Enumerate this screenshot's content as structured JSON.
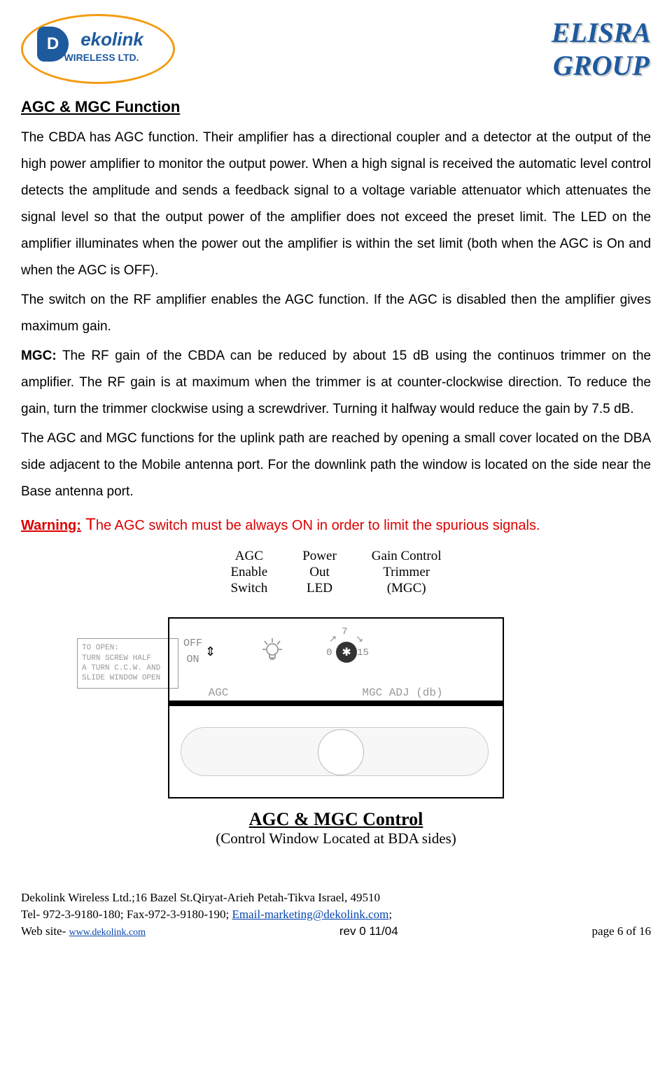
{
  "header": {
    "logo_main": "ekolink",
    "logo_sub": "WIRELESS LTD.",
    "logo_d": "D",
    "right_line1": "ELISRA",
    "right_line2": "GROUP"
  },
  "section": {
    "title": "AGC & MGC Function",
    "p1": "The CBDA has AGC function. Their amplifier has a directional coupler and a detector at the output of the high power amplifier to monitor the output power.  When a high signal is received the automatic level control detects the amplitude and sends a feedback signal to a voltage variable attenuator which attenuates the signal level so that the output power of the amplifier does not exceed the preset limit. The LED on the amplifier illuminates when the power out the amplifier is within the set limit (both when the AGC is On and when the AGC is OFF).",
    "p2": "The switch on the RF amplifier enables the AGC function. If the AGC is disabled then the amplifier gives maximum gain.",
    "mgc_label": "MGC:",
    "p3": " The RF gain of the CBDA can be reduced by about 15 dB using the continuos trimmer on the amplifier. The RF gain is at maximum when the trimmer is at counter-clockwise direction. To reduce the gain, turn the trimmer clockwise using a screwdriver. Turning it halfway would reduce the gain by 7.5 dB.",
    "p4": "The AGC and MGC functions for the uplink path are reached by opening a small cover located on the DBA side adjacent to the Mobile antenna port. For the downlink path the window is located on the side near the Base antenna port.",
    "warning_label": "Warning:",
    "warning_t": " T",
    "warning_text": "he AGC switch must be always ON in order to limit the spurious signals."
  },
  "callouts": {
    "c1_l1": "AGC",
    "c1_l2": "Enable",
    "c1_l3": "Switch",
    "c2_l1": "Power",
    "c2_l2": "Out",
    "c2_l3": "LED",
    "c3_l1": "Gain Control",
    "c3_l2": "Trimmer",
    "c3_l3": "(MGC)"
  },
  "diagram": {
    "off": "OFF",
    "on": "ON",
    "t0": "0",
    "t7": "7",
    "t15": "15",
    "bar_agc": "AGC",
    "bar_mgc": "MGC ADJ (db)",
    "panel_l1": "TO OPEN:",
    "panel_l2": "TURN SCREW HALF",
    "panel_l3": "A TURN C.C.W. AND",
    "panel_l4": "SLIDE WINDOW OPEN"
  },
  "figure": {
    "title": "AGC & MGC Control",
    "subtitle": "(Control Window Located at BDA sides)"
  },
  "footer": {
    "l1": "Dekolink Wireless Ltd.;16 Bazel St.Qiryat-Arieh Petah-Tikva Israel, 49510",
    "l2a": "Tel- 972-3-9180-180; Fax-972-3-9180-190; ",
    "l2b": "Email-marketing@dekolink.com",
    "l2c": ";",
    "l3a": "Web site- ",
    "l3b": "www.dekolink.com",
    "rev": "rev 0  11/04",
    "page": "page 6 of  16"
  }
}
